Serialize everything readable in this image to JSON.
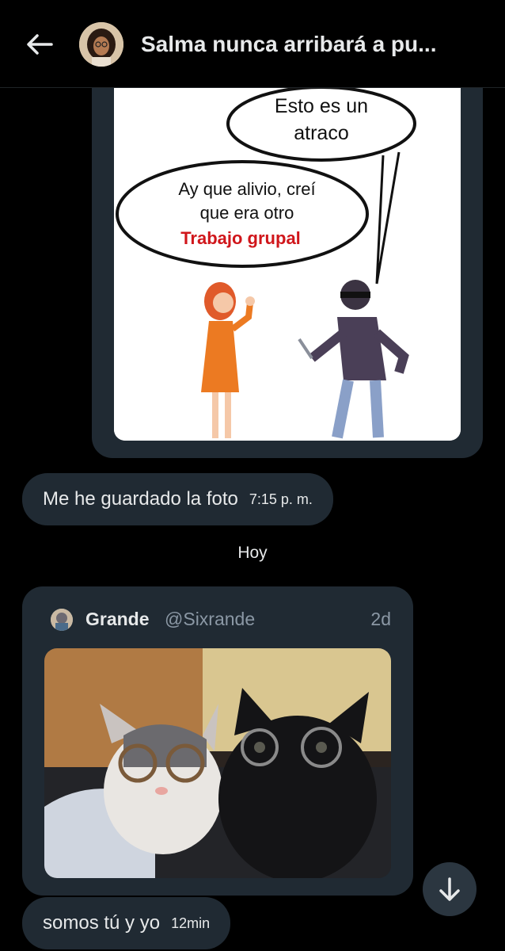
{
  "header": {
    "title": "Salma nunca arribará a pu...",
    "back_icon": "arrow-left-icon",
    "avatar": "contact-avatar"
  },
  "messages": {
    "image_caption": {
      "bubble_1": "Esto es un",
      "bubble_1b": "atraco",
      "bubble_2a": "Ay que alivio, creí",
      "bubble_2b": "que era otro",
      "bubble_2c": "Trabajo grupal"
    },
    "text_1": {
      "text": "Me he guardado la foto",
      "time": "7:15 p. m."
    },
    "day_separator": "Hoy",
    "quote": {
      "name": "Grande",
      "handle": "@Sixrande",
      "age": "2d"
    },
    "text_2": {
      "text": "somos tú y yo",
      "time": "12min"
    }
  },
  "colors": {
    "background": "#000000",
    "bubble": "#202a33",
    "secondary_text": "#8b98a5",
    "accent_red": "#d0161b"
  },
  "icons": {
    "scroll_down": "arrow-down-icon"
  }
}
